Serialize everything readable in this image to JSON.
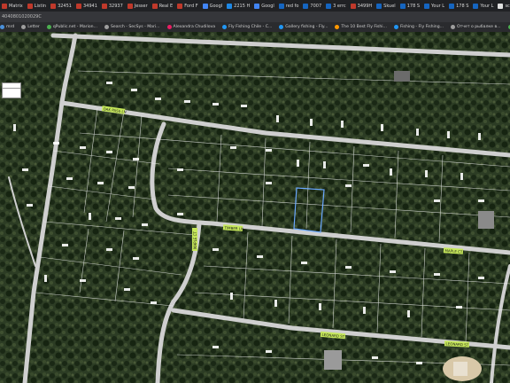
{
  "browser": {
    "tabs": [
      {
        "label": "Matrix",
        "icon": "matrix-icon",
        "color": "#c0392b"
      },
      {
        "label": "Listin",
        "icon": "listing-icon",
        "color": "#c0392b"
      },
      {
        "label": "32451",
        "icon": "listing-icon",
        "color": "#c0392b"
      },
      {
        "label": "34941",
        "icon": "listing-icon",
        "color": "#c0392b"
      },
      {
        "label": "32937",
        "icon": "listing-icon",
        "color": "#c0392b"
      },
      {
        "label": "Jesser",
        "icon": "listing-icon",
        "color": "#c0392b"
      },
      {
        "label": "Real E",
        "icon": "realtor-icon",
        "color": "#c0392b"
      },
      {
        "label": "Ford F",
        "icon": "listing-icon",
        "color": "#c0392b"
      },
      {
        "label": "Googl",
        "icon": "google-icon",
        "color": "#4285f4"
      },
      {
        "label": "2215 H",
        "icon": "listing-icon",
        "color": "#1e88e5"
      },
      {
        "label": "Googl",
        "icon": "google-icon",
        "color": "#4285f4"
      },
      {
        "label": "red fo",
        "icon": "listing-icon",
        "color": "#1565c0"
      },
      {
        "label": "7007",
        "icon": "listing-icon",
        "color": "#1565c0"
      },
      {
        "label": "3 errc",
        "icon": "error-icon",
        "color": "#1565c0"
      },
      {
        "label": "3499H",
        "icon": "listing-icon",
        "color": "#c0392b"
      },
      {
        "label": "Skuel",
        "icon": "listing-icon",
        "color": "#1565c0"
      },
      {
        "label": "178 S",
        "icon": "listing-icon",
        "color": "#1565c0"
      },
      {
        "label": "Your L",
        "icon": "listing-icon",
        "color": "#1565c0"
      },
      {
        "label": "178 S",
        "icon": "listing-icon",
        "color": "#1565c0"
      },
      {
        "label": "Your L",
        "icon": "listing-icon",
        "color": "#1565c0"
      },
      {
        "label": "scanpl",
        "icon": "listing-icon",
        "color": "#e0e0e0"
      }
    ],
    "address": "4040801020029C",
    "bookmarks": [
      {
        "label": "mrd",
        "color": "#4a90d9"
      },
      {
        "label": "Letter",
        "color": "#9e9e9e"
      },
      {
        "label": "qPublic.net - Marion...",
        "color": "#4caf50"
      },
      {
        "label": "Search - SecSys - Mari...",
        "color": "#9e9e9e"
      },
      {
        "label": "Alexandra Chudilova",
        "color": "#e91e63"
      },
      {
        "label": "Fly Fishing Chile - C...",
        "color": "#2196f3"
      },
      {
        "label": "Gallery fishing - Fly...",
        "color": "#2196f3"
      },
      {
        "label": "The 10 Best Fly Fishi...",
        "color": "#ff9800"
      },
      {
        "label": "Fishing - Fly Fishing...",
        "color": "#2196f3"
      },
      {
        "label": "Отчет о рыбалке в...",
        "color": "#9e9e9e"
      },
      {
        "label": "qPublic.net - Marion...",
        "color": "#4caf50"
      },
      {
        "label": "Community Redevel...",
        "color": "#9e9e9e"
      },
      {
        "label": "RealtorsInvi - Mark...",
        "color": "#1565c0"
      }
    ]
  },
  "map": {
    "streets": [
      {
        "label": "OAK PASS LN"
      },
      {
        "label": "MAPLE CT"
      },
      {
        "label": "TIMBER LN"
      },
      {
        "label": "MAPLE CT"
      },
      {
        "label": "LEONARD ST"
      },
      {
        "label": "LEONARD ST"
      }
    ],
    "colors": {
      "street_label_bg": "#c6e85a",
      "selected_parcel": "#6aa8ff",
      "parcel_lines": "#e8e8e8",
      "roads": "#cfcfcf"
    }
  }
}
